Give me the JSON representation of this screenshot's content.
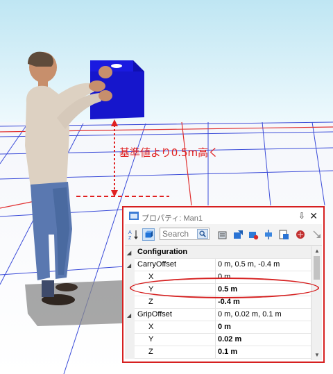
{
  "annotation": {
    "text": "基準値より0.5m高く"
  },
  "panel": {
    "title": "プロパティ: Man1",
    "pin_glyph": "⇩",
    "close_glyph": "✕",
    "search_placeholder": "Search",
    "rows": [
      {
        "name": "Configuration",
        "value": "",
        "type": "category"
      },
      {
        "name": "CarryOffset",
        "value": "0 m, 0.5 m, -0.4 m",
        "type": "expanded"
      },
      {
        "name": "X",
        "value": "0 m",
        "type": "child"
      },
      {
        "name": "Y",
        "value": "0.5 m",
        "type": "child",
        "bold": true
      },
      {
        "name": "Z",
        "value": "-0.4 m",
        "type": "child",
        "bold": true
      },
      {
        "name": "GripOffset",
        "value": "0 m, 0.02 m, 0.1 m",
        "type": "expanded"
      },
      {
        "name": "X",
        "value": "0 m",
        "type": "child",
        "bold": true
      },
      {
        "name": "Y",
        "value": "0.02 m",
        "type": "child",
        "bold": true
      },
      {
        "name": "Z",
        "value": "0.1 m",
        "type": "child",
        "bold": true
      }
    ]
  },
  "colors": {
    "highlight": "#d62020",
    "floor_grid_blue": "#3a4bd8",
    "floor_grid_red": "#e03030",
    "box_blue": "#1a1ae0"
  }
}
